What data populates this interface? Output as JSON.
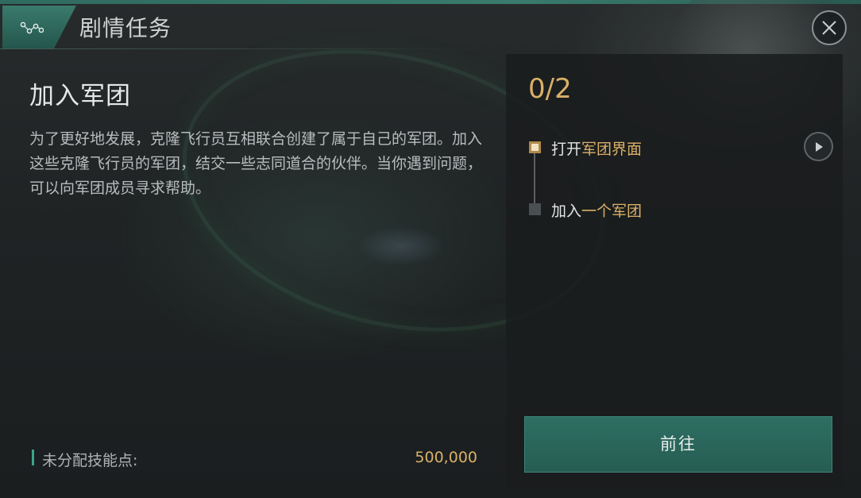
{
  "header": {
    "title": "剧情任务",
    "icon": "route-nodes-icon",
    "close_icon": "close-icon"
  },
  "quest": {
    "title": "加入军团",
    "description": "为了更好地发展，克隆飞行员互相联合创建了属于自己的军团。加入这些克隆飞行员的军团，结交一些志同道合的伙伴。当你遇到问题，可以向军团成员寻求帮助。"
  },
  "skill_points": {
    "label": "未分配技能点:",
    "value": "500,000"
  },
  "objectives": {
    "progress": "0/2",
    "steps": [
      {
        "prefix": "打开",
        "highlight": "军团界面",
        "status": "active"
      },
      {
        "prefix": "加入",
        "highlight": "一个军团",
        "status": "pending"
      }
    ],
    "play_icon": "play-icon"
  },
  "go_button": {
    "label": "前往"
  },
  "colors": {
    "accent_gold": "#d9b068",
    "accent_teal": "#3aa58b",
    "button_teal": "#2e6e62"
  }
}
